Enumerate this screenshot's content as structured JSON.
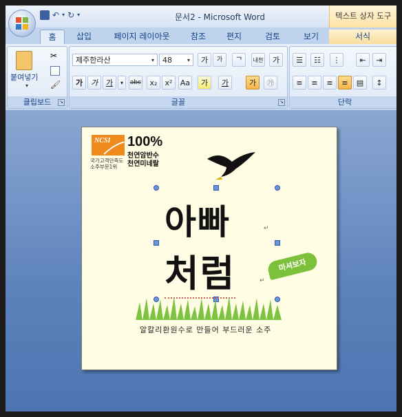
{
  "window": {
    "title": "문서2 - Microsoft Word",
    "context_title": "텍스트 상자 도구"
  },
  "tabs": [
    "홈",
    "삽입",
    "페이지 레이아웃",
    "참조",
    "편지",
    "검토",
    "보기",
    "서식"
  ],
  "active_tab": "홈",
  "clipboard": {
    "paste_label": "붙여넣기",
    "group_label": "클립보드"
  },
  "font": {
    "name": "제주한라산",
    "size": "48",
    "group_label": "글꼴",
    "buttons": [
      "가",
      "가",
      "가",
      "abc",
      "x₂",
      "x²",
      "Aa",
      "가",
      "가"
    ]
  },
  "paragraph": {
    "group_label": "단락"
  },
  "document": {
    "ncsi": "NCSI",
    "percent": "100%",
    "tagline_1": "천연암반수",
    "tagline_2": "천연미네랄",
    "small_1": "국가고객만족도",
    "small_2": "소주부문1위",
    "headline_1": "아빠",
    "headline_2": "처럼",
    "badge": "마셔보자",
    "caption": "알칼리환원수로 만들어 부드러운 소주"
  },
  "colors": {
    "accent_orange": "#f08a1c",
    "badge_green": "#7dc03b",
    "page_bg": "#fffde3"
  }
}
